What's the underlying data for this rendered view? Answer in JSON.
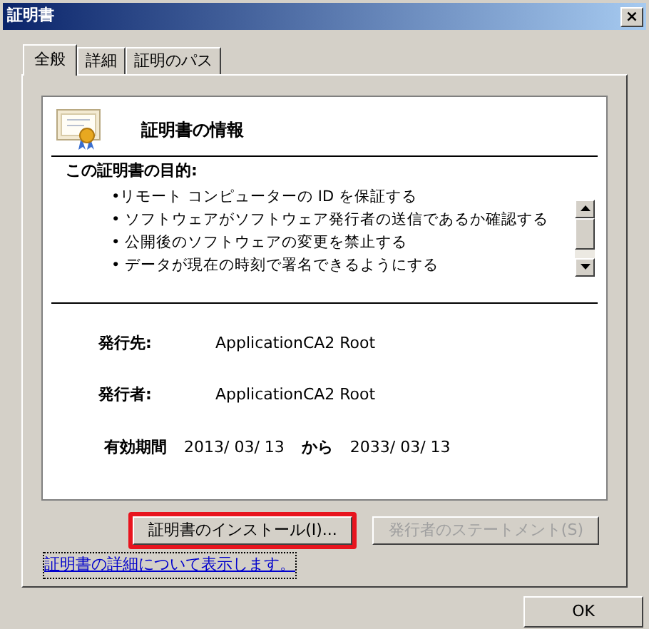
{
  "window": {
    "title": "証明書",
    "close": "×"
  },
  "tabs": [
    {
      "label": "全般",
      "selected": true
    },
    {
      "label": "詳細",
      "selected": false
    },
    {
      "label": "証明のパス",
      "selected": false
    }
  ],
  "info": {
    "heading": "証明書の情報",
    "purpose_label": "この証明書の目的:",
    "purposes": [
      "•リモート コンピューターの ID を保証する",
      "• ソフトウェアがソフトウェア発行者の送信であるか確認する",
      "• 公開後のソフトウェアの変更を禁止する",
      "• データが現在の時刻で署名できるようにする"
    ],
    "fields": [
      {
        "label": "発行先:",
        "value": "ApplicationCA2 Root"
      },
      {
        "label": "発行者:",
        "value": "ApplicationCA2 Root"
      }
    ],
    "validity": {
      "label": "有効期間",
      "from": "2013/ 03/ 13",
      "from_word": "から",
      "to": "2033/ 03/ 13"
    }
  },
  "buttons": [
    {
      "label": "証明書のインストール(I)...",
      "disabled": false,
      "highlighted": true
    },
    {
      "label": "発行者のステートメント(S)",
      "disabled": true,
      "highlighted": false
    }
  ],
  "link": "証明書の詳細について表示します。",
  "ok": "OK"
}
